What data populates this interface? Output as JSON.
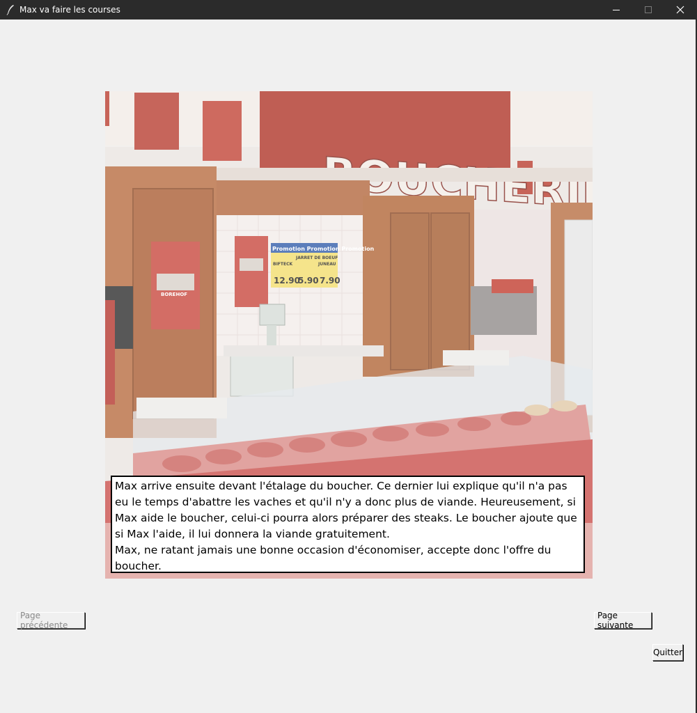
{
  "window": {
    "title": "Max va faire les courses",
    "icons": {
      "app": "feather-icon",
      "minimize": "minimize-icon",
      "maximize": "maximize-icon",
      "close": "close-icon"
    }
  },
  "scene": {
    "sign_text": "BOUCHERIE",
    "poster_title": "Promotion Promotion Promotion",
    "poster_items": [
      "BIFTECK",
      "JARRET DE BOEUF",
      "JUNEAU"
    ],
    "poster_prices": [
      "12.90",
      "5.90",
      "7.90"
    ],
    "brand_label": "BOREHOF"
  },
  "narration": {
    "line1": "Max arrive ensuite devant l'étalage du boucher. Ce dernier lui explique qu'il n'a pas eu le temps d'abattre les vaches et qu'il n'y a donc plus de viande. Heureusement, si Max aide le boucher, celui-ci pourra alors préparer des steaks. Le boucher ajoute que si Max l'aide, il lui donnera la viande gratuitement.",
    "line2": "Max, ne ratant jamais une bonne occasion d'économiser, accepte donc l'offre du boucher."
  },
  "buttons": {
    "previous": "Page précédente",
    "next": "Page suivante",
    "quit": "Quitter"
  },
  "colors": {
    "titlebar": "#2b2b2b",
    "window_bg": "#f0f0f0",
    "disabled_text": "#8a8a8a"
  }
}
